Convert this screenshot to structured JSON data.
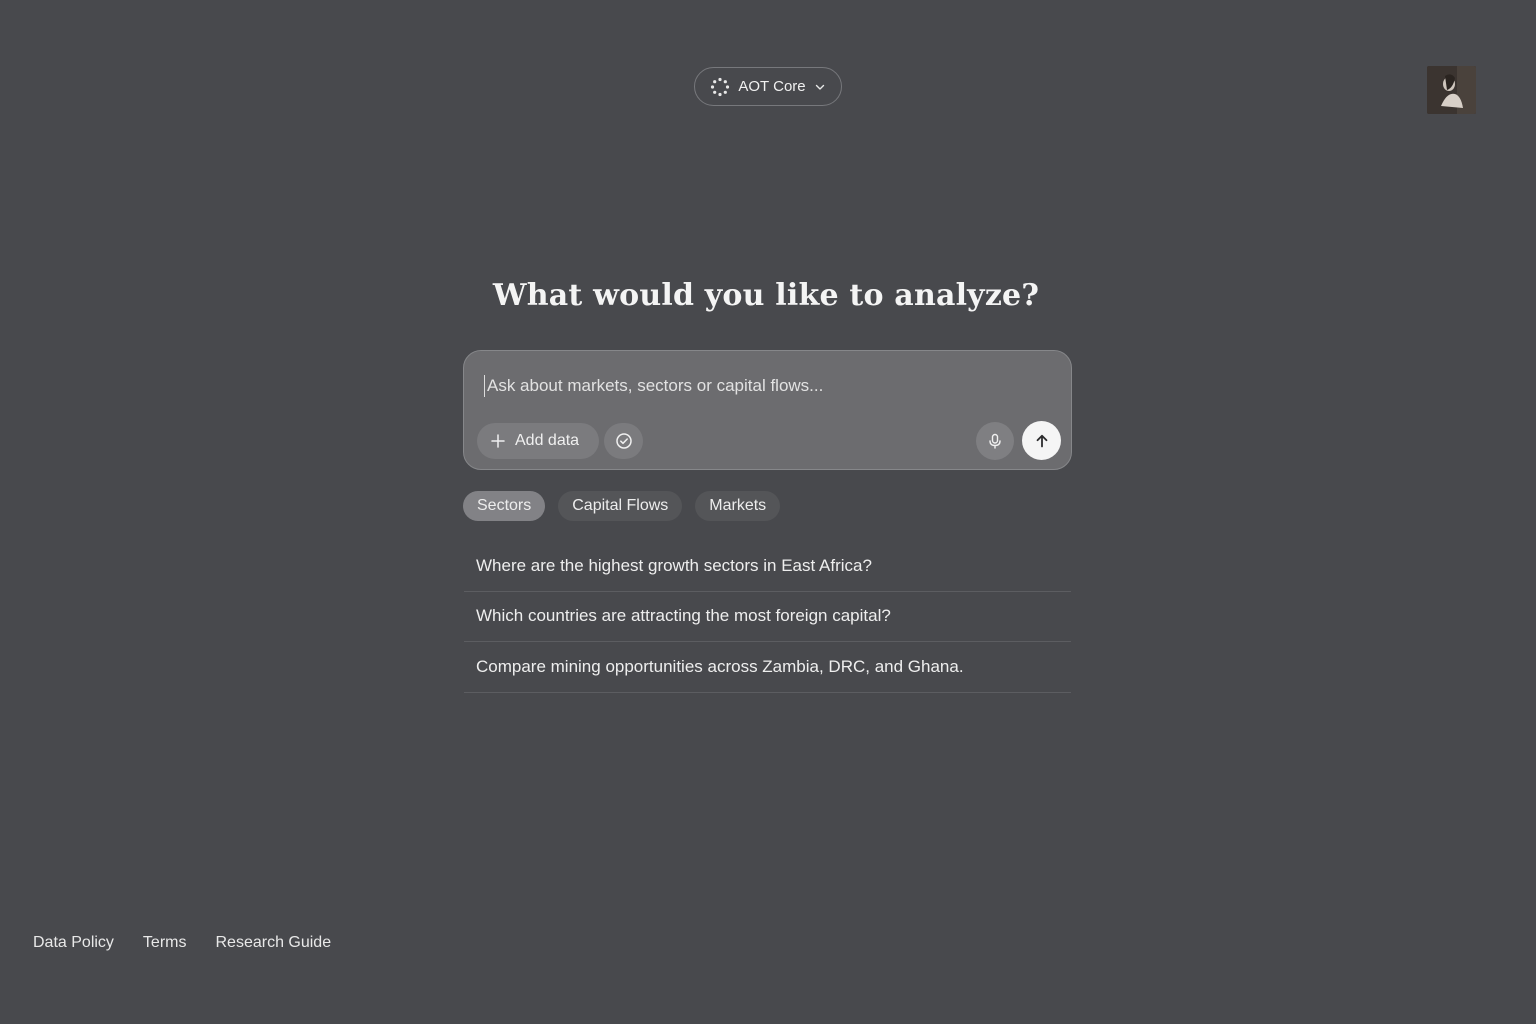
{
  "header": {
    "model_selector": {
      "label": "AOT Core",
      "icon": "dotted-circle-icon",
      "chevron": "chevron-down-icon"
    },
    "avatar": {
      "icon": "user-avatar"
    }
  },
  "main": {
    "heading": "What would you like to analyze?",
    "composer": {
      "placeholder": "Ask about markets, sectors or capital flows...",
      "value": "",
      "add_data_label": "Add data",
      "icons": {
        "add": "plus-icon",
        "check": "check-circle-icon",
        "mic": "microphone-icon",
        "send": "arrow-up-icon"
      }
    },
    "chips": [
      {
        "label": "Sectors",
        "active": true
      },
      {
        "label": "Capital Flows",
        "active": false
      },
      {
        "label": "Markets",
        "active": false
      }
    ],
    "suggestions": [
      "Where are the highest growth sectors in East Africa?",
      "Which countries are attracting the most foreign capital?",
      "Compare mining opportunities across Zambia, DRC, and Ghana."
    ]
  },
  "footer": {
    "links": [
      "Data Policy",
      "Terms",
      "Research Guide"
    ]
  },
  "colors": {
    "background": "#48494d",
    "composer": "#6c6c6f",
    "chip_active": "#828286",
    "send_button": "#f5f5f5"
  }
}
